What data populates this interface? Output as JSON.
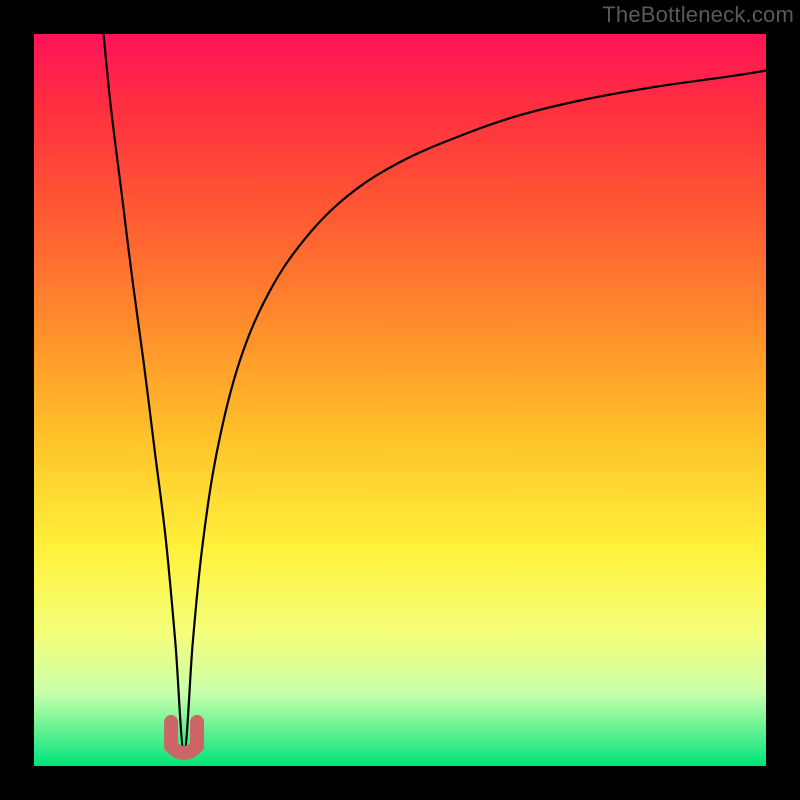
{
  "attribution": "TheBottleneck.com",
  "chart_data": {
    "type": "line",
    "title": "",
    "xlabel": "",
    "ylabel": "",
    "xlim": [
      0,
      100
    ],
    "ylim": [
      0,
      100
    ],
    "frame": {
      "color": "#000000",
      "thickness_px": 34
    },
    "background_gradient": {
      "direction": "vertical",
      "stops": [
        {
          "color": "#ff1358",
          "offset": 0.0
        },
        {
          "color": "#ff2f3f",
          "offset": 0.1
        },
        {
          "color": "#ff5b33",
          "offset": 0.25
        },
        {
          "color": "#ff8d2b",
          "offset": 0.4
        },
        {
          "color": "#ffc22a",
          "offset": 0.55
        },
        {
          "color": "#fff13a",
          "offset": 0.7
        },
        {
          "color": "#f4ff7a",
          "offset": 0.82
        },
        {
          "color": "#c9ffab",
          "offset": 0.9
        },
        {
          "color": "#00e47a",
          "offset": 1.0
        }
      ]
    },
    "annotations": [
      {
        "name": "dip-marker",
        "color": "#cc6666",
        "shape": "u",
        "approx_x": 20.5,
        "approx_y": 3
      }
    ],
    "series": [
      {
        "name": "bottleneck-curve",
        "color": "#000000",
        "stroke_px": 2,
        "x": [
          9.5,
          10.5,
          12.0,
          13.5,
          15.0,
          16.5,
          18.0,
          19.3,
          20.5,
          21.7,
          23.0,
          25.0,
          28.0,
          32.0,
          37.0,
          43.0,
          50.0,
          58.0,
          66.0,
          75.0,
          85.0,
          95.0,
          100.0
        ],
        "y": [
          100.0,
          90.0,
          78.0,
          66.0,
          55.0,
          43.0,
          31.0,
          17.0,
          2.0,
          17.0,
          30.0,
          43.0,
          55.0,
          64.5,
          72.0,
          78.0,
          82.5,
          86.0,
          88.8,
          91.0,
          92.8,
          94.2,
          95.0
        ]
      }
    ]
  }
}
